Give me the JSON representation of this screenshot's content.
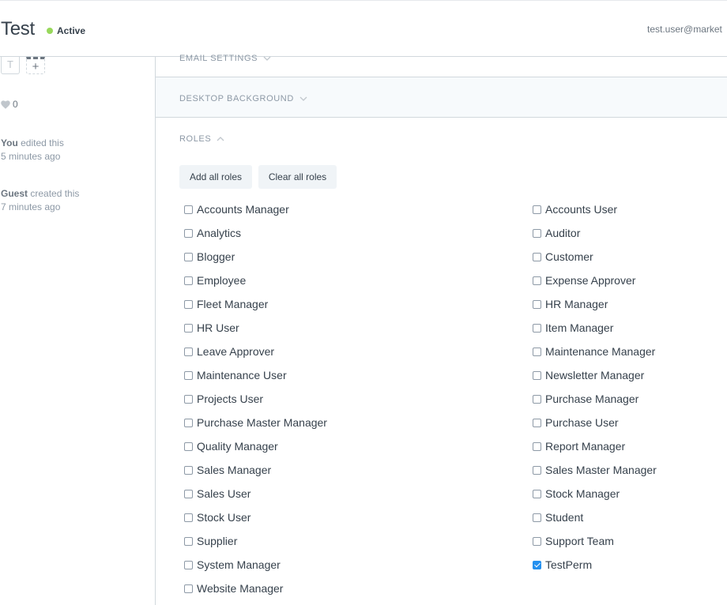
{
  "header": {
    "title": "Test",
    "status": "Active",
    "user_email": "test.user@market"
  },
  "sidebar": {
    "tag_letter": "T",
    "tag_add": "+",
    "likes_count": "0",
    "activity": [
      {
        "who": "You",
        "action": "edited this",
        "when": "5 minutes ago"
      },
      {
        "who": "Guest",
        "action": "created this",
        "when": "7 minutes ago"
      }
    ]
  },
  "sections": {
    "email_settings": "EMAIL SETTINGS",
    "desktop_background": "DESKTOP BACKGROUND",
    "roles": "ROLES"
  },
  "buttons": {
    "add_all": "Add all roles",
    "clear_all": "Clear all roles"
  },
  "colors": {
    "accent": "#2490ef",
    "active_dot": "#98d85b",
    "border": "#d1d8dd"
  },
  "roles_left": [
    {
      "label": "Accounts Manager",
      "checked": false
    },
    {
      "label": "Analytics",
      "checked": false
    },
    {
      "label": "Blogger",
      "checked": false
    },
    {
      "label": "Employee",
      "checked": false
    },
    {
      "label": "Fleet Manager",
      "checked": false
    },
    {
      "label": "HR User",
      "checked": false
    },
    {
      "label": "Leave Approver",
      "checked": false
    },
    {
      "label": "Maintenance User",
      "checked": false
    },
    {
      "label": "Projects User",
      "checked": false
    },
    {
      "label": "Purchase Master Manager",
      "checked": false
    },
    {
      "label": "Quality Manager",
      "checked": false
    },
    {
      "label": "Sales Manager",
      "checked": false
    },
    {
      "label": "Sales User",
      "checked": false
    },
    {
      "label": "Stock User",
      "checked": false
    },
    {
      "label": "Supplier",
      "checked": false
    },
    {
      "label": "System Manager",
      "checked": false
    },
    {
      "label": "Website Manager",
      "checked": false
    }
  ],
  "roles_right": [
    {
      "label": "Accounts User",
      "checked": false
    },
    {
      "label": "Auditor",
      "checked": false
    },
    {
      "label": "Customer",
      "checked": false
    },
    {
      "label": "Expense Approver",
      "checked": false
    },
    {
      "label": "HR Manager",
      "checked": false
    },
    {
      "label": "Item Manager",
      "checked": false
    },
    {
      "label": "Maintenance Manager",
      "checked": false
    },
    {
      "label": "Newsletter Manager",
      "checked": false
    },
    {
      "label": "Purchase Manager",
      "checked": false
    },
    {
      "label": "Purchase User",
      "checked": false
    },
    {
      "label": "Report Manager",
      "checked": false
    },
    {
      "label": "Sales Master Manager",
      "checked": false
    },
    {
      "label": "Stock Manager",
      "checked": false
    },
    {
      "label": "Student",
      "checked": false
    },
    {
      "label": "Support Team",
      "checked": false
    },
    {
      "label": "TestPerm",
      "checked": true
    }
  ]
}
